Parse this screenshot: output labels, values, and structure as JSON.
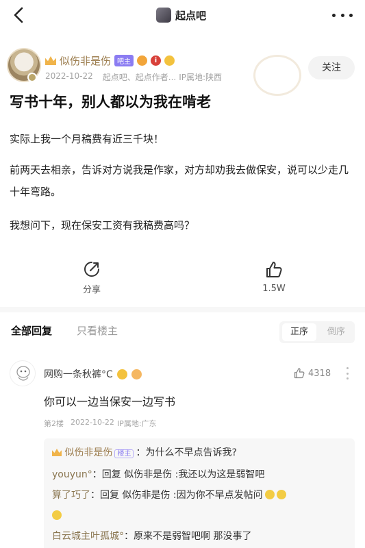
{
  "topbar": {
    "bar_name": "起点吧"
  },
  "post": {
    "author": {
      "name": "似伤非是伤",
      "tag": "吧主",
      "date": "2022-10-22",
      "source": "起点吧、起点作者...",
      "ip": "IP属地:陕西",
      "medal_mid": "i"
    },
    "follow_label": "关注",
    "title": "写书十年，别人都以为我在啃老",
    "paragraphs": [
      "实际上我一个月稿费有近三千块！",
      "前两天去相亲，告诉对方说我是作家，对方却劝我去做保安，说可以少走几十年弯路。",
      "我想问下，现在保安工资有我稿费高吗？"
    ],
    "share_label": "分享",
    "like_count": "1.5W"
  },
  "replies": {
    "tab_all": "全部回复",
    "tab_owner": "只看楼主",
    "sort_asc": "正序",
    "sort_desc": "倒序"
  },
  "comment": {
    "name": "网购一条秋裤°C",
    "likes": "4318",
    "text": "你可以一边当保安一边写书",
    "floor": "第2楼",
    "date": "2022-10-22",
    "ip": "IP属地:广东",
    "subs": [
      {
        "who": "似伤非是伤",
        "tag": "楼主",
        "text": "：为什么不早点告诉我?"
      },
      {
        "who": "youyun°",
        "text": "：回复 似伤非是伤 :我还以为这是弱智吧"
      },
      {
        "who": "算了巧了",
        "text": "：回复 似伤非是伤 :因为你不早点发帖问"
      },
      {
        "who": "白云城主叶孤城°",
        "text": "：原来不是弱智吧啊 那没事了"
      }
    ]
  }
}
